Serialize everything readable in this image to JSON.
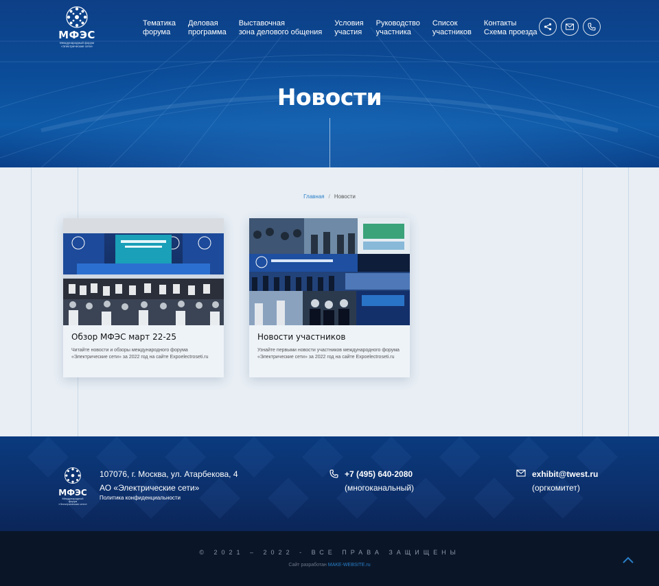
{
  "header": {
    "logo": {
      "name": "МФЭС",
      "subtitle_line1": "Международный форум",
      "subtitle_line2": "«Электрические сети»"
    },
    "nav": [
      {
        "line1": "Тематика",
        "line2": "форума"
      },
      {
        "line1": "Деловая",
        "line2": "программа"
      },
      {
        "line1": "Выставочная",
        "line2": "зона делового общения"
      },
      {
        "line1": "Условия",
        "line2": "участия"
      },
      {
        "line1": "Руководство",
        "line2": "участника"
      },
      {
        "line1": "Список",
        "line2": "участников"
      },
      {
        "line1": "Контакты",
        "line2": "Схема проезда"
      }
    ],
    "social_icons": [
      "share-icon",
      "mail-icon",
      "phone-icon"
    ]
  },
  "hero": {
    "title": "Новости"
  },
  "breadcrumb": {
    "home": "Главная",
    "separator": "/",
    "current": "Новости"
  },
  "cards": [
    {
      "title": "Обзор МФЭС март 22-25",
      "description": "Читайте новости и обзоры международного форума «Электрические сети» за 2022 год на сайте Expoelectroseti.ru"
    },
    {
      "title": "Новости участников",
      "description": "Узнайте первыми новости участников международного форума «Электрические сети» за 2022 год на сайте Expoelectroseti.ru"
    }
  ],
  "footer": {
    "logo": {
      "name": "МФЭС",
      "subtitle_line1": "Международный форум",
      "subtitle_line2": "«Электрические сети»"
    },
    "address": "107076, г. Москва, ул. Атарбекова, 4",
    "company": "АО «Электрические сети»",
    "policy": "Политика конфиденциальности",
    "phone": "+7 (495) 640-2080",
    "phone_note": "(многоканальный)",
    "email": "exhibit@twest.ru",
    "email_note": "(оргкомитет)",
    "copyright": "© 2021 – 2022 - ВСЕ ПРАВА ЗАЩИЩЕНЫ",
    "made_by_prefix": "Сайт разработан",
    "made_by_link": "MAKE-WEBSITE.ru"
  },
  "colors": {
    "hero_blue": "#0b4c98",
    "accent_link": "#2a7fc8",
    "footer_blue": "#0c2f6a",
    "bottom_bar": "#0a1628"
  }
}
